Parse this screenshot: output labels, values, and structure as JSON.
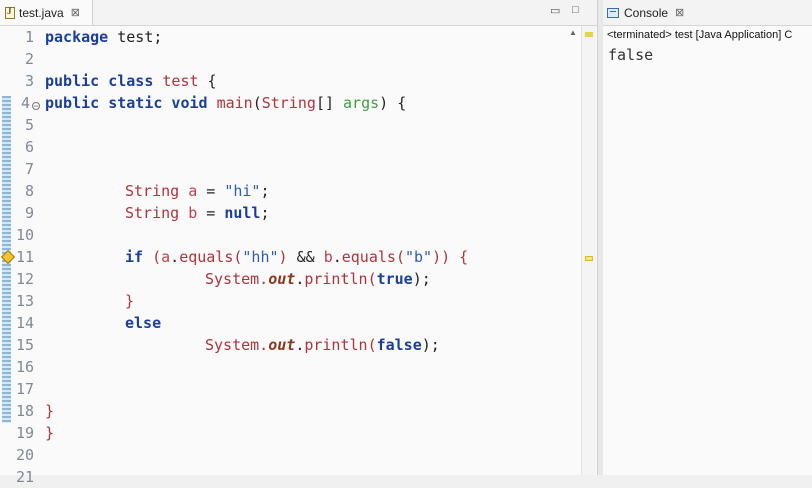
{
  "editor": {
    "tab_label": "test.java",
    "tab_close": "⊠",
    "minimize": "▭",
    "maximize": "□",
    "line_numbers": [
      "1",
      "2",
      "3",
      "4",
      "5",
      "6",
      "7",
      "8",
      "9",
      "10",
      "11",
      "12",
      "13",
      "14",
      "15",
      "16",
      "17",
      "18",
      "19",
      "20",
      "21"
    ],
    "code": {
      "l1_kw": "package",
      "l1_rest": " test;",
      "l3_kw": "public class",
      "l3_name": " test",
      "l3_rest": " {",
      "l4_kw": "public static void",
      "l4_mt": " main",
      "l4_open": "(",
      "l4_tp": "String",
      "l4_arr": "[] ",
      "l4_pm": "args",
      "l4_close": ") {",
      "l8_tp": "String",
      "l8_var": " a",
      "l8_eq": " = ",
      "l8_str": "\"hi\"",
      "l8_end": ";",
      "l9_tp": "String",
      "l9_var": " b",
      "l9_eq": " = ",
      "l9_kw": "null",
      "l9_end": ";",
      "l11_kw": "if",
      "l11_p1": " (",
      "l11_a": "a",
      "l11_dot1": ".",
      "l11_eq1": "equals",
      "l11_p2": "(",
      "l11_s1": "\"hh\"",
      "l11_p3": ")",
      "l11_and": " && ",
      "l11_b": "b",
      "l11_dot2": ".",
      "l11_eq2": "equals",
      "l11_p4": "(",
      "l11_s2": "\"b\"",
      "l11_p5": ")) {",
      "l12_sys": "System.",
      "l12_out": "out",
      "l12_dot": ".",
      "l12_m": "println",
      "l12_p": "(",
      "l12_kw": "true",
      "l12_e": ");",
      "l13": "}",
      "l14": "else",
      "l15_sys": "System.",
      "l15_out": "out",
      "l15_dot": ".",
      "l15_m": "println",
      "l15_p": "(",
      "l15_kw": "false",
      "l15_e": ");",
      "l18": "}",
      "l19": "}"
    }
  },
  "console": {
    "tab_label": "Console",
    "tab_close": "⊠",
    "status": "<terminated> test [Java Application] C",
    "output": "false"
  },
  "colors": {
    "keyword": "#1a3f9b",
    "type": "#b0333b",
    "param": "#3e9f3e",
    "string": "#2a5db0"
  }
}
